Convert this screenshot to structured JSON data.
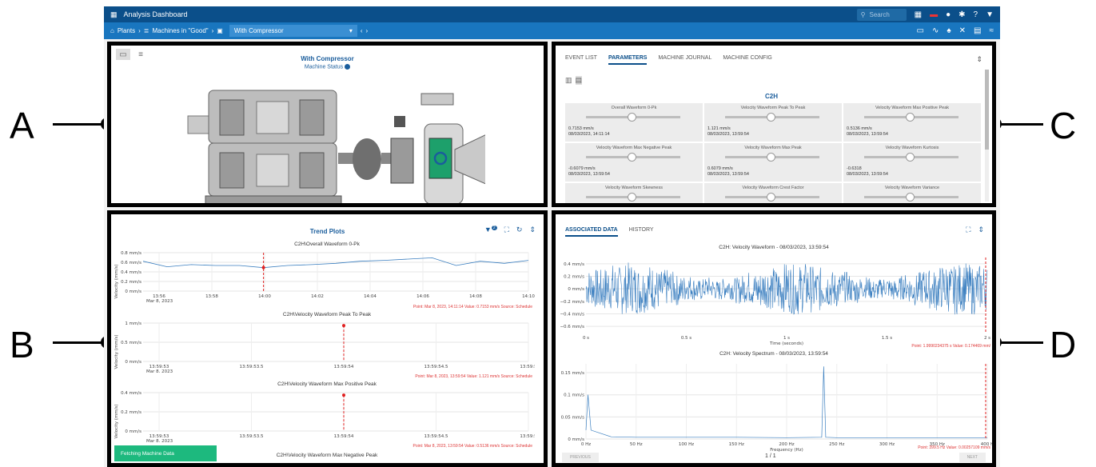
{
  "topbar": {
    "title": "Analysis Dashboard",
    "search_placeholder": "Search"
  },
  "navbar": {
    "crumb1": "Plants",
    "crumb2": "Machines in \"Good\"",
    "selected": "With Compressor"
  },
  "callouts": {
    "a": "A",
    "b": "B",
    "c": "C",
    "d": "D"
  },
  "panelA": {
    "title": "With Compressor",
    "status": "Machine Status"
  },
  "panelC": {
    "tabs": [
      "EVENT LIST",
      "PARAMETERS",
      "MACHINE JOURNAL",
      "MACHINE CONFIG"
    ],
    "group": "C2H",
    "params": [
      {
        "name": "Overall Waveform 0-Pk",
        "value": "0.7153 mm/s",
        "date": "08/03/2023, 14:11:14"
      },
      {
        "name": "Velocity Waveform Peak To Peak",
        "value": "1.121 mm/s",
        "date": "08/03/2023, 13:59:54"
      },
      {
        "name": "Velocity Waveform Max Positive Peak",
        "value": "0.5136 mm/s",
        "date": "08/03/2023, 13:59:54"
      },
      {
        "name": "Velocity Waveform Max Negative Peak",
        "value": "-0.6079 mm/s",
        "date": "08/03/2023, 13:59:54"
      },
      {
        "name": "Velocity Waveform Max Peak",
        "value": "0.6079 mm/s",
        "date": "08/03/2023, 13:59:54"
      },
      {
        "name": "Velocity Waveform Kurtosis",
        "value": "-0.6318",
        "date": "08/03/2023, 13:59:54"
      },
      {
        "name": "Velocity Waveform Skewness",
        "value": "",
        "date": ""
      },
      {
        "name": "Velocity Waveform Crest Factor",
        "value": "",
        "date": ""
      },
      {
        "name": "Velocity Waveform Variance",
        "value": "",
        "date": ""
      }
    ]
  },
  "panelB": {
    "title": "Trend Plots",
    "filter_count": "2",
    "ylabel": "Velocity (mm/s)",
    "plot1": {
      "title": "C2H\\Overall Waveform 0-Pk",
      "yticks": [
        "0.8 mm/s",
        "0.6 mm/s",
        "0.4 mm/s",
        "0.2 mm/s",
        "0 mm/s"
      ],
      "xticks": [
        "13:56",
        "13:58",
        "14:00",
        "14:02",
        "14:04",
        "14:06",
        "14:08",
        "14:10"
      ],
      "xdate": "Mar 8, 2023",
      "footer": "Point: Mar 8, 2023, 14:11:14   Value: 0.7153 mm/s   Source: Schedule"
    },
    "plot2": {
      "title": "C2H\\Velocity Waveform Peak To Peak",
      "yticks": [
        "1 mm/s",
        "0.5 mm/s",
        "0 mm/s"
      ],
      "xticks": [
        "13:59:53",
        "13:59:53.5",
        "13:59:54",
        "13:59:54.5",
        "13:59:5"
      ],
      "xdate": "Mar 8, 2023",
      "footer": "Point: Mar 8, 2023, 13:59:54   Value: 1.121 mm/s   Source: Schedule"
    },
    "plot3": {
      "title": "C2H\\Velocity Waveform Max Positive Peak",
      "yticks": [
        "0.4 mm/s",
        "0.2 mm/s",
        "0 mm/s"
      ],
      "xticks": [
        "13:59:53",
        "13:59:53.5",
        "13:59:54",
        "13:59:54.5",
        "13:59:5"
      ],
      "xdate": "Mar 8, 2023",
      "footer": "Point: Mar 8, 2023, 13:59:54   Value: 0.5136 mm/s   Source: Schedule"
    },
    "plot4_title": "C2H\\Velocity Waveform Max Negative Peak",
    "fetching": "Fetching Machine Data"
  },
  "panelD": {
    "tabs": [
      "ASSOCIATED DATA",
      "HISTORY"
    ],
    "wave": {
      "title": "C2H: Velocity Waveform - 08/03/2023, 13:59:54",
      "yticks": [
        "0.4 mm/s",
        "0.2 mm/s",
        "0 mm/s",
        "−0.2 mm/s",
        "−0.4 mm/s",
        "−0.6 mm/s"
      ],
      "xticks": [
        "0 s",
        "0.5 s",
        "1 s",
        "1.5 s",
        "2 s"
      ],
      "xlabel": "Time (seconds)",
      "footer": "Point: 1.9990234375 s   Value: 0.174469 mm/"
    },
    "spectrum": {
      "title": "C2H: Velocity Spectrum - 08/03/2023, 13:59:54",
      "yticks": [
        "0.15 mm/s",
        "0.1 mm/s",
        "0.05 mm/s",
        "0 mm/s"
      ],
      "xticks": [
        "0 Hz",
        "50 Hz",
        "100 Hz",
        "150 Hz",
        "200 Hz",
        "250 Hz",
        "300 Hz",
        "350 Hz",
        "400 H"
      ],
      "xlabel": "Frequency (Hz)",
      "footer": "Point: 399.5 Hz   Value: 0.00257109 mm/s"
    },
    "prev": "PREVIOUS",
    "page": "1 / 1",
    "next": "NEXT"
  },
  "chart_data": [
    {
      "type": "line",
      "title": "C2H\\Overall Waveform 0-Pk",
      "ylabel": "Velocity (mm/s)",
      "x": [
        "13:55",
        "13:56",
        "13:57",
        "13:58",
        "13:59",
        "14:00",
        "14:01",
        "14:02",
        "14:03",
        "14:04",
        "14:05",
        "14:06",
        "14:07",
        "14:08",
        "14:09",
        "14:10",
        "14:11"
      ],
      "series": [
        {
          "values": [
            0.7,
            0.57,
            0.62,
            0.6,
            0.6,
            0.55,
            0.6,
            0.62,
            0.65,
            0.7,
            0.72,
            0.75,
            0.78,
            0.6,
            0.7,
            0.65,
            0.72
          ]
        }
      ],
      "ylim": [
        0,
        0.9
      ]
    },
    {
      "type": "scatter",
      "title": "C2H\\Velocity Waveform Peak To Peak",
      "x": [
        "13:59:54"
      ],
      "series": [
        {
          "values": [
            1.121
          ]
        }
      ],
      "ylim": [
        0,
        1.2
      ]
    },
    {
      "type": "scatter",
      "title": "C2H\\Velocity Waveform Max Positive Peak",
      "x": [
        "13:59:54"
      ],
      "series": [
        {
          "values": [
            0.5136
          ]
        }
      ],
      "ylim": [
        0,
        0.55
      ]
    },
    {
      "type": "line",
      "title": "C2H: Velocity Waveform - 08/03/2023, 13:59:54",
      "xlabel": "Time (seconds)",
      "xlim": [
        0,
        2
      ],
      "ylim": [
        -0.7,
        0.5
      ]
    },
    {
      "type": "line",
      "title": "C2H: Velocity Spectrum - 08/03/2023, 13:59:54",
      "xlabel": "Frequency (Hz)",
      "x": [
        0,
        2,
        5,
        25,
        50,
        100,
        150,
        200,
        235,
        237,
        239,
        250,
        300,
        350,
        400
      ],
      "series": [
        {
          "values": [
            0.02,
            0.1,
            0.02,
            0.005,
            0.004,
            0.004,
            0.004,
            0.003,
            0.004,
            0.164,
            0.004,
            0.003,
            0.003,
            0.003,
            0.003
          ]
        }
      ],
      "xlim": [
        0,
        400
      ],
      "ylim": [
        0,
        0.17
      ]
    }
  ]
}
